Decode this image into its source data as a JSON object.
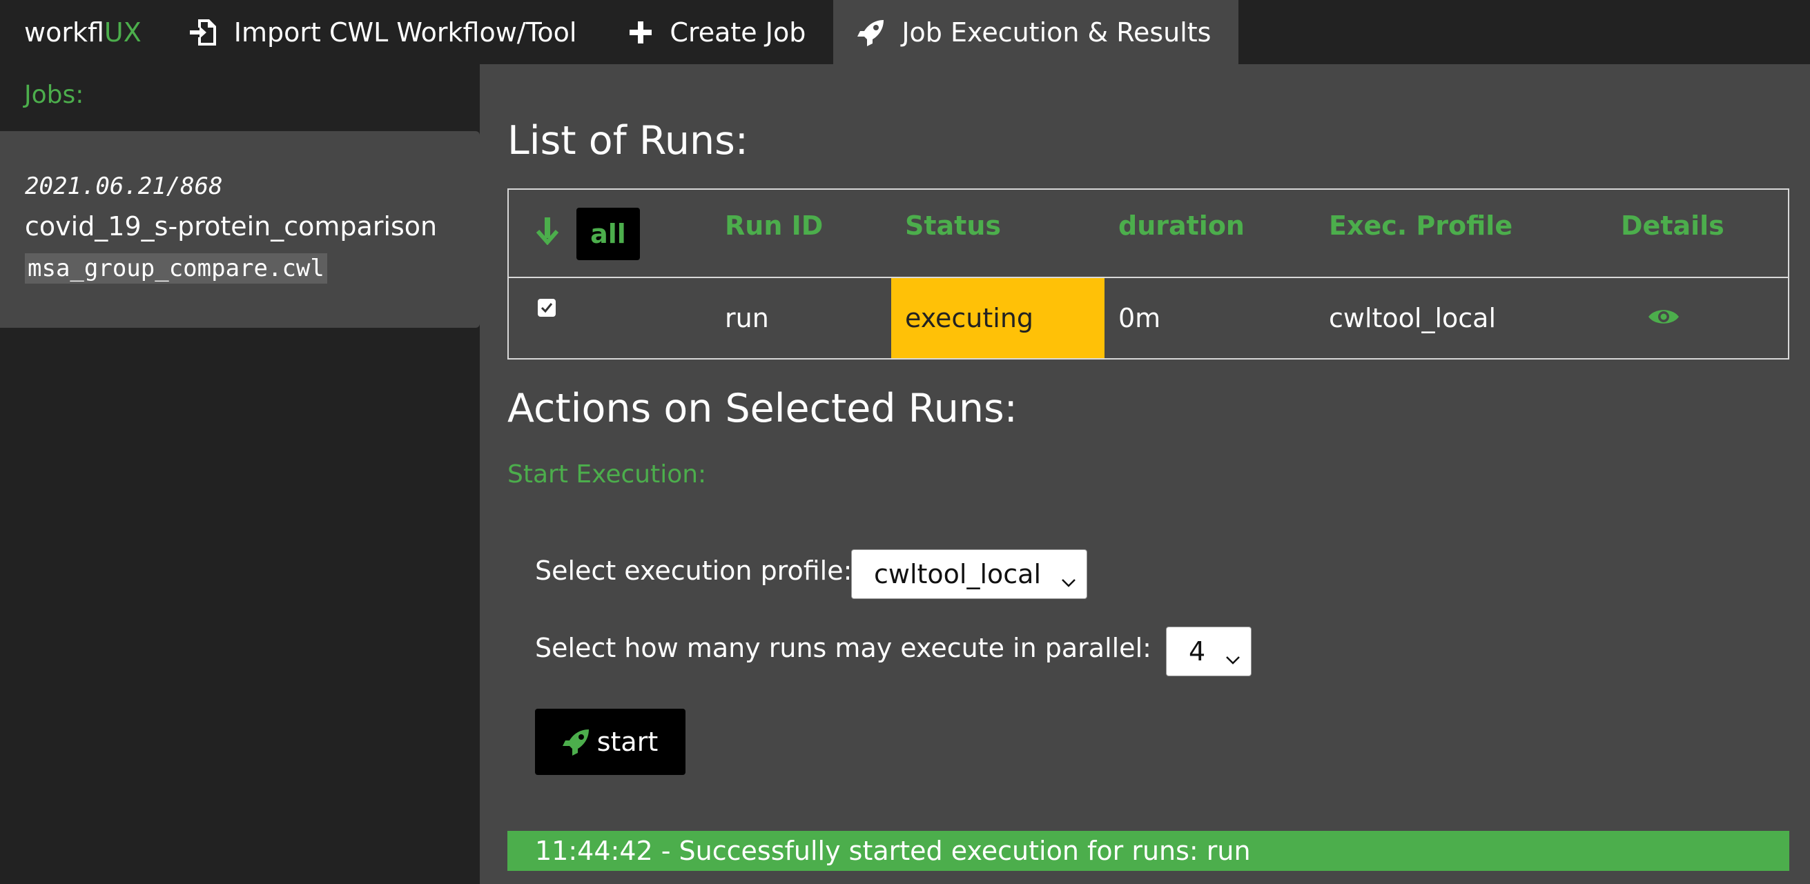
{
  "brand": {
    "prefix": "workfl",
    "accent": "UX"
  },
  "nav": {
    "import": "Import CWL Workflow/Tool",
    "create": "Create Job",
    "results": "Job Execution & Results"
  },
  "sidebar": {
    "title": "Jobs:",
    "job": {
      "date": "2021.06.21/868",
      "name": "covid_19_s-protein_comparison",
      "file": "msa_group_compare.cwl"
    }
  },
  "main": {
    "list_title": "List of Runs:",
    "table": {
      "all_label": "all",
      "headers": [
        "Run ID",
        "Status",
        "duration",
        "Exec. Profile",
        "Details"
      ],
      "rows": [
        {
          "checked": true,
          "run_id": "run",
          "status": "executing",
          "duration": "0m",
          "profile": "cwltool_local"
        }
      ]
    },
    "actions_title": "Actions on Selected Runs:",
    "start_execution": "Start Execution:",
    "profile_label": "Select execution profile:",
    "profile_value": "cwltool_local",
    "parallel_label": "Select how many runs may execute in parallel:",
    "parallel_value": "4",
    "start_label": "start",
    "status_message": "11:44:42 - Successfully started execution for runs: run"
  },
  "colors": {
    "accent": "#4cae4c",
    "status_executing": "#ffc107",
    "background": "#474747",
    "nav": "#222222"
  }
}
